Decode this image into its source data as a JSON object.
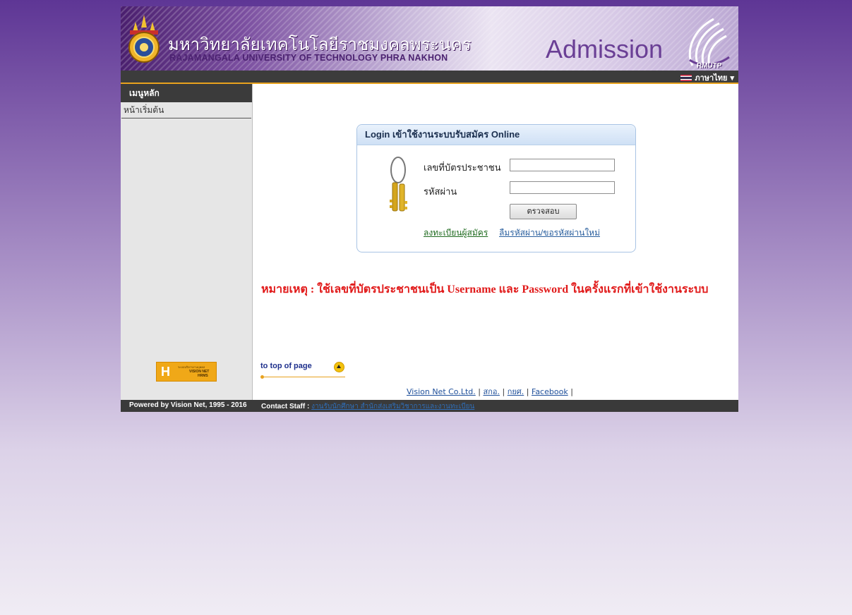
{
  "header": {
    "university_th": "มหาวิทยาลัยเทคโนโลยีราชมงคลพระนคร",
    "university_en": "RAJAMANGALA UNIVERSITY OF TECHNOLOGY PHRA NAKHON",
    "admission": "Admission",
    "rmutp": "RMUTP",
    "language": "ภาษาไทย"
  },
  "sidebar": {
    "heading": "เมนูหลัก",
    "items": [
      {
        "label": "หน้าเริ่มต้น"
      }
    ],
    "vision_logo": {
      "letter": "H",
      "line1": "ระบบบริหารงานบุคคล",
      "line2": "VISION NET",
      "line3": "HRMS"
    }
  },
  "login": {
    "title": "Login เข้าใช้งานระบบรับสมัคร Online",
    "id_label": "เลขที่บัตรประชาชน",
    "id_value": "",
    "password_label": "รหัสผ่าน",
    "password_value": "",
    "submit_label": "ตรวจสอบ",
    "register_link": "ลงทะเบียนผู้สมัคร",
    "forgot_link": "ลืมรหัสผ่าน/ขอรหัสผ่านใหม่"
  },
  "note": "หมายเหตุ : ใช้เลขที่บัตรประชาชนเป็น Username และ Password ในครั้งแรกที่เข้าใช้งานระบบ",
  "to_top": "to top of page",
  "footer": {
    "links": [
      "Vision Net Co.Ltd.",
      "สกอ.",
      "กยศ.",
      "Facebook"
    ],
    "separator": "|",
    "powered": "Powered by Vision Net, 1995 - 2016",
    "contact_label": "Contact Staff :",
    "contact_link": "งานรับนักศึกษา สำนักส่งเสริมวิชาการและงานทะเบียน"
  },
  "colors": {
    "accent": "#e8a21e",
    "note": "#e11a1a",
    "login_border": "#a9c4e4"
  }
}
